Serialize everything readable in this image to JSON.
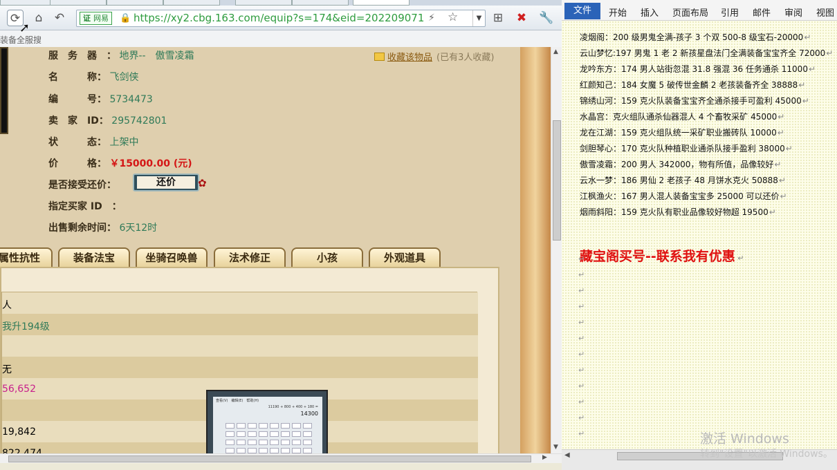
{
  "browser": {
    "address": {
      "site_badge_icon": "证",
      "site_badge": "网易",
      "url": "https://xy2.cbg.163.com/equip?s=174&eid=202209071200213"
    },
    "subbar_text": "装备全服搜"
  },
  "item": {
    "favorite": {
      "label": "收藏该物品",
      "count_note": "(已有3人收藏)"
    },
    "fields": [
      {
        "label": "服　务　器　：",
        "value": "地界--　傲雪凌霜"
      },
      {
        "label": "名　　　称：",
        "value": "飞剑侠"
      },
      {
        "label": "编　　　号：",
        "value": "5734473"
      },
      {
        "label": "卖　家　ID：",
        "value": "295742801"
      },
      {
        "label": "状　　　态：",
        "value": "上架中"
      },
      {
        "label": "价　　　格：",
        "value": "￥15000.00 (元)"
      },
      {
        "label": "是否接受还价：",
        "value": ""
      },
      {
        "label": "指定买家 ID　：",
        "value": ""
      },
      {
        "label": "出售剩余时间：",
        "value": "6天12时"
      }
    ],
    "counter_offer_button": "还价",
    "tabs": [
      "属性抗性",
      "装备法宝",
      "坐骑召唤兽",
      "法术修正",
      "小孩",
      "外观道具"
    ],
    "panel_rows": [
      {
        "text": "人",
        "color": "#3a2e1a"
      },
      {
        "text": "我升194级",
        "color": "#2f7a58"
      },
      {
        "text": "",
        "color": "#3a2e1a"
      },
      {
        "text": "无",
        "color": "#3a2e1a"
      },
      {
        "text": "56,652",
        "color": "#c8208c"
      },
      {
        "text": "",
        "color": "#3a2e1a"
      },
      {
        "text": "19,842",
        "color": "#3a2e1a"
      },
      {
        "text": "822,474",
        "color": "#3a2e1a"
      }
    ]
  },
  "calculator": {
    "menu": "查看(V)　编辑(E)　帮助(H)",
    "expression": "11190 + 800 + 400 + 180 =",
    "result": "14300"
  },
  "word": {
    "tabs": [
      "文件",
      "开始",
      "插入",
      "页面布局",
      "引用",
      "邮件",
      "审阅",
      "视图"
    ],
    "lines": [
      "凌烟阁：200 级男鬼全满-孩子 3 个双 500-8 级宝石-20000",
      "云山梦忆:197 男鬼 1 老 2 新孩星盘法门全满装备宝宝齐全 72000",
      "龙吟东方：174 男人站街忽混 31.8 强混 36 任务通杀 11000",
      "红颜知己：184 女魔 5 破传世金麟 2 老孩装备齐全 38888",
      "锦绣山河：159 克火队装备宝宝齐全通杀接手可盈利 45000",
      "水晶宫：克火组队通杀仙器混人 4 个畜牧采矿 45000",
      "龙在江湖：159 克火组队统一采矿职业搬砖队 10000",
      "剑胆琴心：170 克火队种植职业通杀队接手盈利 38000",
      "傲雪凌霜：200 男人 342000，物有所值，品像较好",
      "云水一梦：186 男仙 2 老孩子 48 月饼水克火 50888",
      "江枫渔火：167 男人混人装备宝宝多 25000 可以还价",
      "烟雨斜阳：159 克火队有职业品像较好物超 19500"
    ],
    "promo": "藏宝阁买号--联系我有优惠",
    "watermark_title": "激活 Windows",
    "watermark_sub": "转到\"设置\"以激活 Windows。"
  }
}
